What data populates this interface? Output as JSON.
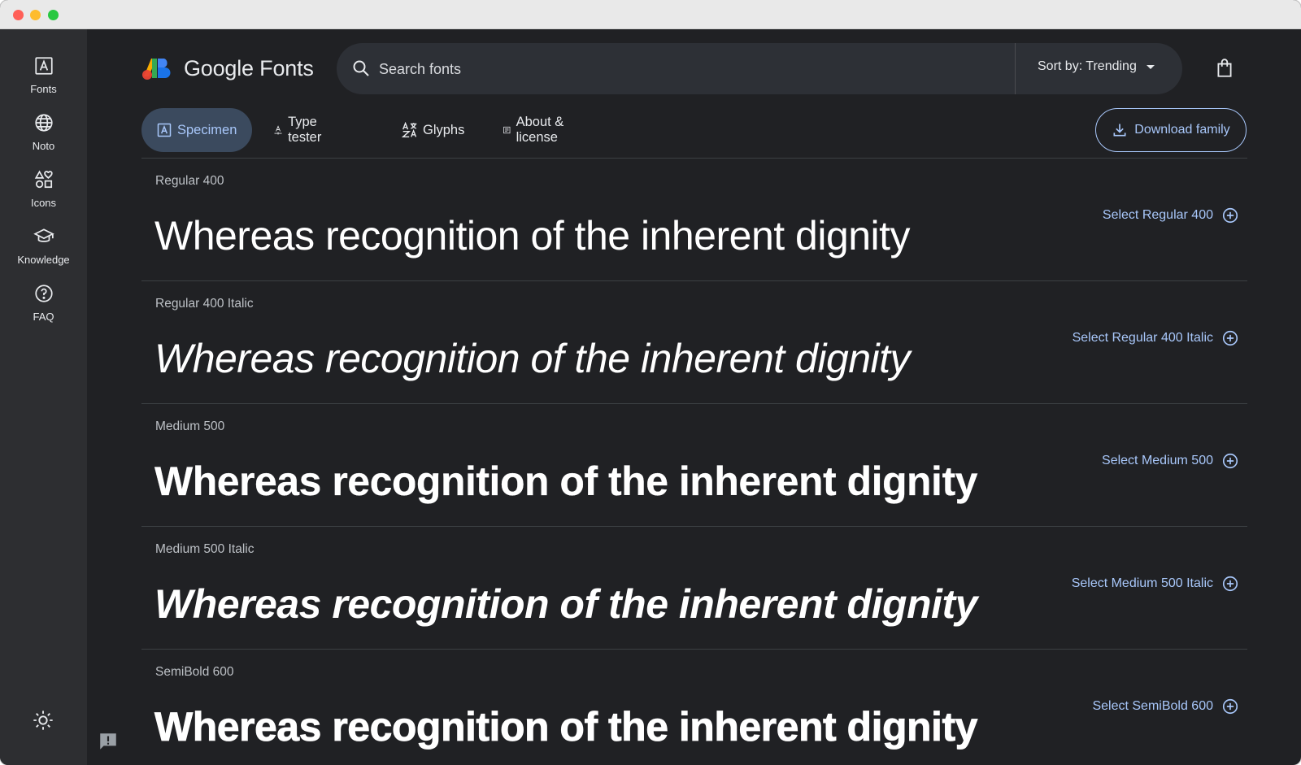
{
  "window": {
    "traffic_lights": [
      "close",
      "minimize",
      "zoom"
    ]
  },
  "rail": {
    "items": [
      {
        "label": "Fonts",
        "icon": "font-icon"
      },
      {
        "label": "Noto",
        "icon": "globe-icon"
      },
      {
        "label": "Icons",
        "icon": "shapes-icon"
      },
      {
        "label": "Knowledge",
        "icon": "school-icon"
      },
      {
        "label": "FAQ",
        "icon": "help-icon"
      }
    ],
    "theme_icon": "sun-icon",
    "feedback_icon": "feedback-icon"
  },
  "header": {
    "brand": "Google Fonts",
    "search_placeholder": "Search fonts",
    "sort_label": "Sort by: Trending",
    "bag_icon": "shopping-bag-icon"
  },
  "tabs": [
    {
      "label": "Specimen",
      "active": true
    },
    {
      "label": "Type tester",
      "active": false
    },
    {
      "label": "Glyphs",
      "active": false
    },
    {
      "label": "About & license",
      "active": false
    }
  ],
  "download_label": "Download family",
  "sample_text": "Whereas recognition of the inherent dignity",
  "styles": [
    {
      "label": "Regular 400",
      "select": "Select Regular 400",
      "weight": 400,
      "italic": false
    },
    {
      "label": "Regular 400 Italic",
      "select": "Select Regular 400 Italic",
      "weight": 400,
      "italic": true
    },
    {
      "label": "Medium 500",
      "select": "Select Medium 500",
      "weight": 500,
      "italic": false
    },
    {
      "label": "Medium 500 Italic",
      "select": "Select Medium 500 Italic",
      "weight": 500,
      "italic": true
    },
    {
      "label": "SemiBold 600",
      "select": "Select SemiBold 600",
      "weight": 600,
      "italic": false
    }
  ],
  "colors": {
    "background": "#202124",
    "rail": "#2d2e31",
    "accent": "#a8c7fa",
    "active_tab": "#3b4a5e",
    "text": "#e8eaed"
  }
}
